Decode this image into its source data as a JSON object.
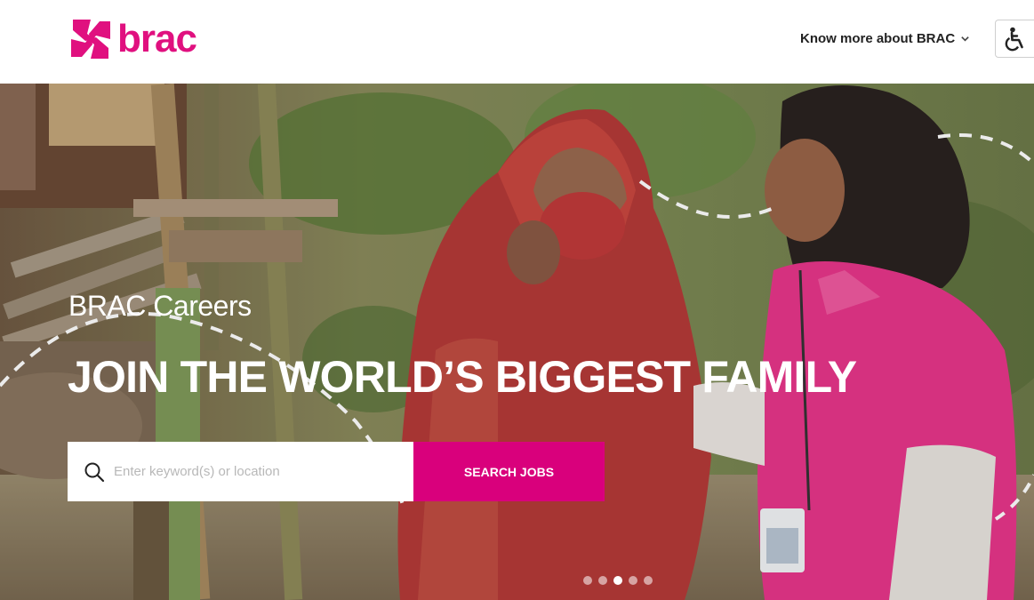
{
  "header": {
    "logo_text": "brac",
    "nav_link": "Know more about BRAC",
    "brand_color": "#e0107f"
  },
  "hero": {
    "subtitle": "BRAC Careers",
    "title": "JOIN THE WORLD’S BIGGEST FAMILY",
    "search": {
      "placeholder": "Enter keyword(s) or location",
      "value": ""
    },
    "search_button": "SEARCH JOBS",
    "button_color": "#d9007c",
    "carousel": {
      "slides": 5,
      "active": 3
    }
  },
  "icons": {
    "logo": "brac-pinwheel-logo-icon",
    "chevron": "chevron-down-icon",
    "accessibility": "wheelchair-accessibility-icon",
    "search": "search-icon"
  }
}
